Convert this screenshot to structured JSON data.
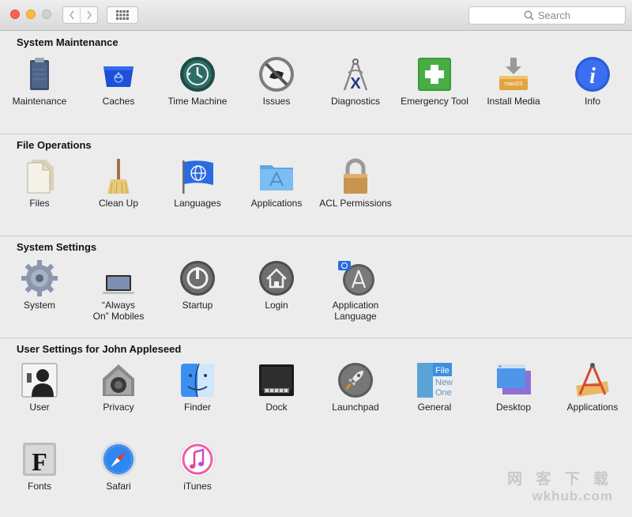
{
  "toolbar": {
    "search_placeholder": "Search"
  },
  "sections": [
    {
      "title": "System Maintenance",
      "items": [
        {
          "label": "Maintenance",
          "icon": "clipboard-icon"
        },
        {
          "label": "Caches",
          "icon": "recycle-bin-icon"
        },
        {
          "label": "Time Machine",
          "icon": "time-machine-icon"
        },
        {
          "label": "Issues",
          "icon": "issues-icon"
        },
        {
          "label": "Diagnostics",
          "icon": "caliper-icon"
        },
        {
          "label": "Emergency Tool",
          "icon": "first-aid-icon"
        },
        {
          "label": "Install Media",
          "icon": "install-drive-icon"
        },
        {
          "label": "Info",
          "icon": "info-icon"
        }
      ]
    },
    {
      "title": "File Operations",
      "items": [
        {
          "label": "Files",
          "icon": "files-icon"
        },
        {
          "label": "Clean Up",
          "icon": "broom-icon"
        },
        {
          "label": "Languages",
          "icon": "language-flag-icon"
        },
        {
          "label": "Applications",
          "icon": "applications-folder-icon"
        },
        {
          "label": "ACL Permissions",
          "icon": "padlock-icon"
        }
      ]
    },
    {
      "title": "System Settings",
      "items": [
        {
          "label": "System",
          "icon": "gear-icon"
        },
        {
          "label": "“Always\nOn” Mobiles",
          "icon": "laptop-icon"
        },
        {
          "label": "Startup",
          "icon": "power-icon"
        },
        {
          "label": "Login",
          "icon": "home-icon"
        },
        {
          "label": "Application\nLanguage",
          "icon": "app-language-icon"
        }
      ]
    },
    {
      "title": "User Settings for John Appleseed",
      "items": [
        {
          "label": "User",
          "icon": "user-silhouette-icon"
        },
        {
          "label": "Privacy",
          "icon": "privacy-house-icon"
        },
        {
          "label": "Finder",
          "icon": "finder-icon"
        },
        {
          "label": "Dock",
          "icon": "dock-icon"
        },
        {
          "label": "Launchpad",
          "icon": "rocket-icon"
        },
        {
          "label": "General",
          "icon": "general-window-icon"
        },
        {
          "label": "Desktop",
          "icon": "desktop-icon"
        },
        {
          "label": "Applications",
          "icon": "app-tools-icon"
        },
        {
          "label": "Fonts",
          "icon": "font-f-icon"
        },
        {
          "label": "Safari",
          "icon": "compass-icon"
        },
        {
          "label": "iTunes",
          "icon": "music-note-icon"
        }
      ]
    }
  ],
  "general_icon_text": [
    "File",
    "New",
    "One"
  ],
  "watermark": [
    "网 客 下 载",
    "wkhub.com"
  ]
}
